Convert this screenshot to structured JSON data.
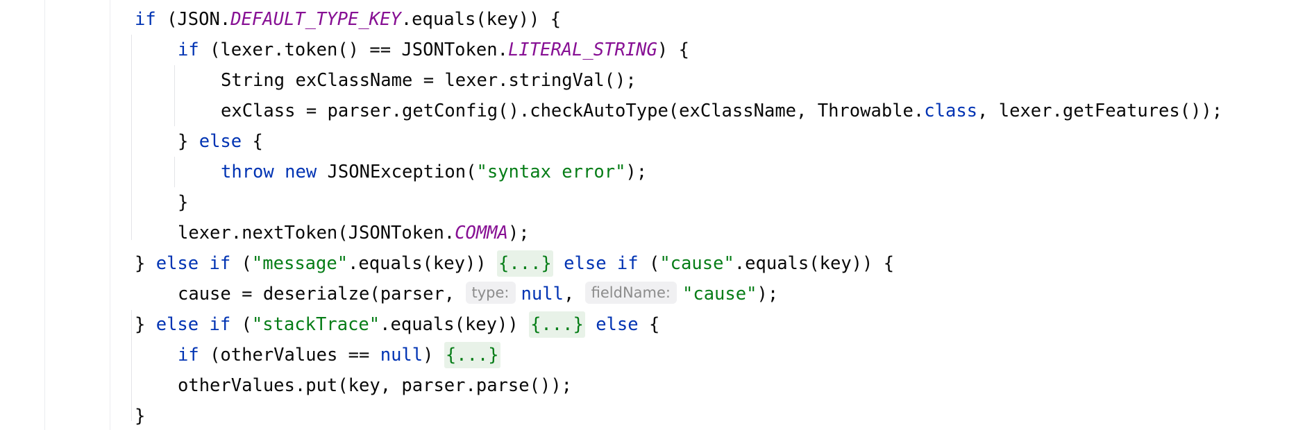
{
  "editor": {
    "lines": [
      {
        "indent": 1,
        "tokens": [
          {
            "t": "kw",
            "v": "if"
          },
          {
            "t": "plain",
            "v": " (JSON."
          },
          {
            "t": "const",
            "v": "DEFAULT_TYPE_KEY"
          },
          {
            "t": "plain",
            "v": ".equals(key)) {"
          }
        ]
      },
      {
        "indent": 2,
        "tokens": [
          {
            "t": "kw",
            "v": "if"
          },
          {
            "t": "plain",
            "v": " (lexer.token() == JSONToken."
          },
          {
            "t": "const",
            "v": "LITERAL_STRING"
          },
          {
            "t": "plain",
            "v": ") {"
          }
        ]
      },
      {
        "indent": 3,
        "tokens": [
          {
            "t": "plain",
            "v": "String exClassName = lexer.stringVal();"
          }
        ]
      },
      {
        "indent": 3,
        "tokens": [
          {
            "t": "plain",
            "v": "exClass = parser.getConfig().checkAutoType(exClassName, Throwable."
          },
          {
            "t": "kw",
            "v": "class"
          },
          {
            "t": "plain",
            "v": ", lexer.getFeatures());"
          }
        ]
      },
      {
        "indent": 2,
        "tokens": [
          {
            "t": "plain",
            "v": "} "
          },
          {
            "t": "kw",
            "v": "else"
          },
          {
            "t": "plain",
            "v": " {"
          }
        ]
      },
      {
        "indent": 3,
        "tokens": [
          {
            "t": "kw",
            "v": "throw"
          },
          {
            "t": "plain",
            "v": " "
          },
          {
            "t": "kw",
            "v": "new"
          },
          {
            "t": "plain",
            "v": " JSONException("
          },
          {
            "t": "str",
            "v": "\"syntax error\""
          },
          {
            "t": "plain",
            "v": ");"
          }
        ]
      },
      {
        "indent": 2,
        "tokens": [
          {
            "t": "plain",
            "v": "}"
          }
        ]
      },
      {
        "indent": 2,
        "tokens": [
          {
            "t": "plain",
            "v": "lexer.nextToken(JSONToken."
          },
          {
            "t": "const",
            "v": "COMMA"
          },
          {
            "t": "plain",
            "v": ");"
          }
        ]
      },
      {
        "indent": 1,
        "tokens": [
          {
            "t": "plain",
            "v": "} "
          },
          {
            "t": "kw",
            "v": "else if"
          },
          {
            "t": "plain",
            "v": " ("
          },
          {
            "t": "str",
            "v": "\"message\""
          },
          {
            "t": "plain",
            "v": ".equals(key)) "
          },
          {
            "t": "fold",
            "v": "{...}"
          },
          {
            "t": "plain",
            "v": " "
          },
          {
            "t": "kw",
            "v": "else if"
          },
          {
            "t": "plain",
            "v": " ("
          },
          {
            "t": "str",
            "v": "\"cause\""
          },
          {
            "t": "plain",
            "v": ".equals(key)) {"
          }
        ]
      },
      {
        "indent": 2,
        "tokens": [
          {
            "t": "plain",
            "v": "cause = deserialze(parser, "
          },
          {
            "t": "hint",
            "v": "type:"
          },
          {
            "t": "kw",
            "v": "null"
          },
          {
            "t": "plain",
            "v": ", "
          },
          {
            "t": "hint",
            "v": "fieldName:"
          },
          {
            "t": "str",
            "v": "\"cause\""
          },
          {
            "t": "plain",
            "v": ");"
          }
        ]
      },
      {
        "indent": 1,
        "tokens": [
          {
            "t": "plain",
            "v": "} "
          },
          {
            "t": "kw",
            "v": "else if"
          },
          {
            "t": "plain",
            "v": " ("
          },
          {
            "t": "str",
            "v": "\"stackTrace\""
          },
          {
            "t": "plain",
            "v": ".equals(key)) "
          },
          {
            "t": "fold",
            "v": "{...}"
          },
          {
            "t": "plain",
            "v": " "
          },
          {
            "t": "kw",
            "v": "else"
          },
          {
            "t": "plain",
            "v": " {"
          }
        ]
      },
      {
        "indent": 2,
        "tokens": [
          {
            "t": "kw",
            "v": "if"
          },
          {
            "t": "plain",
            "v": " (otherValues == "
          },
          {
            "t": "kw",
            "v": "null"
          },
          {
            "t": "plain",
            "v": ") "
          },
          {
            "t": "fold",
            "v": "{...}"
          }
        ]
      },
      {
        "indent": 2,
        "tokens": [
          {
            "t": "plain",
            "v": "otherValues.put(key, parser.parse());"
          }
        ]
      },
      {
        "indent": 1,
        "tokens": [
          {
            "t": "plain",
            "v": "}"
          }
        ]
      }
    ]
  },
  "colors": {
    "keyword": "#0033b3",
    "constant": "#871094",
    "string": "#067d17",
    "text": "#080808",
    "fold_background": "#e8f2e8",
    "hint_text": "#8c8c8c"
  }
}
